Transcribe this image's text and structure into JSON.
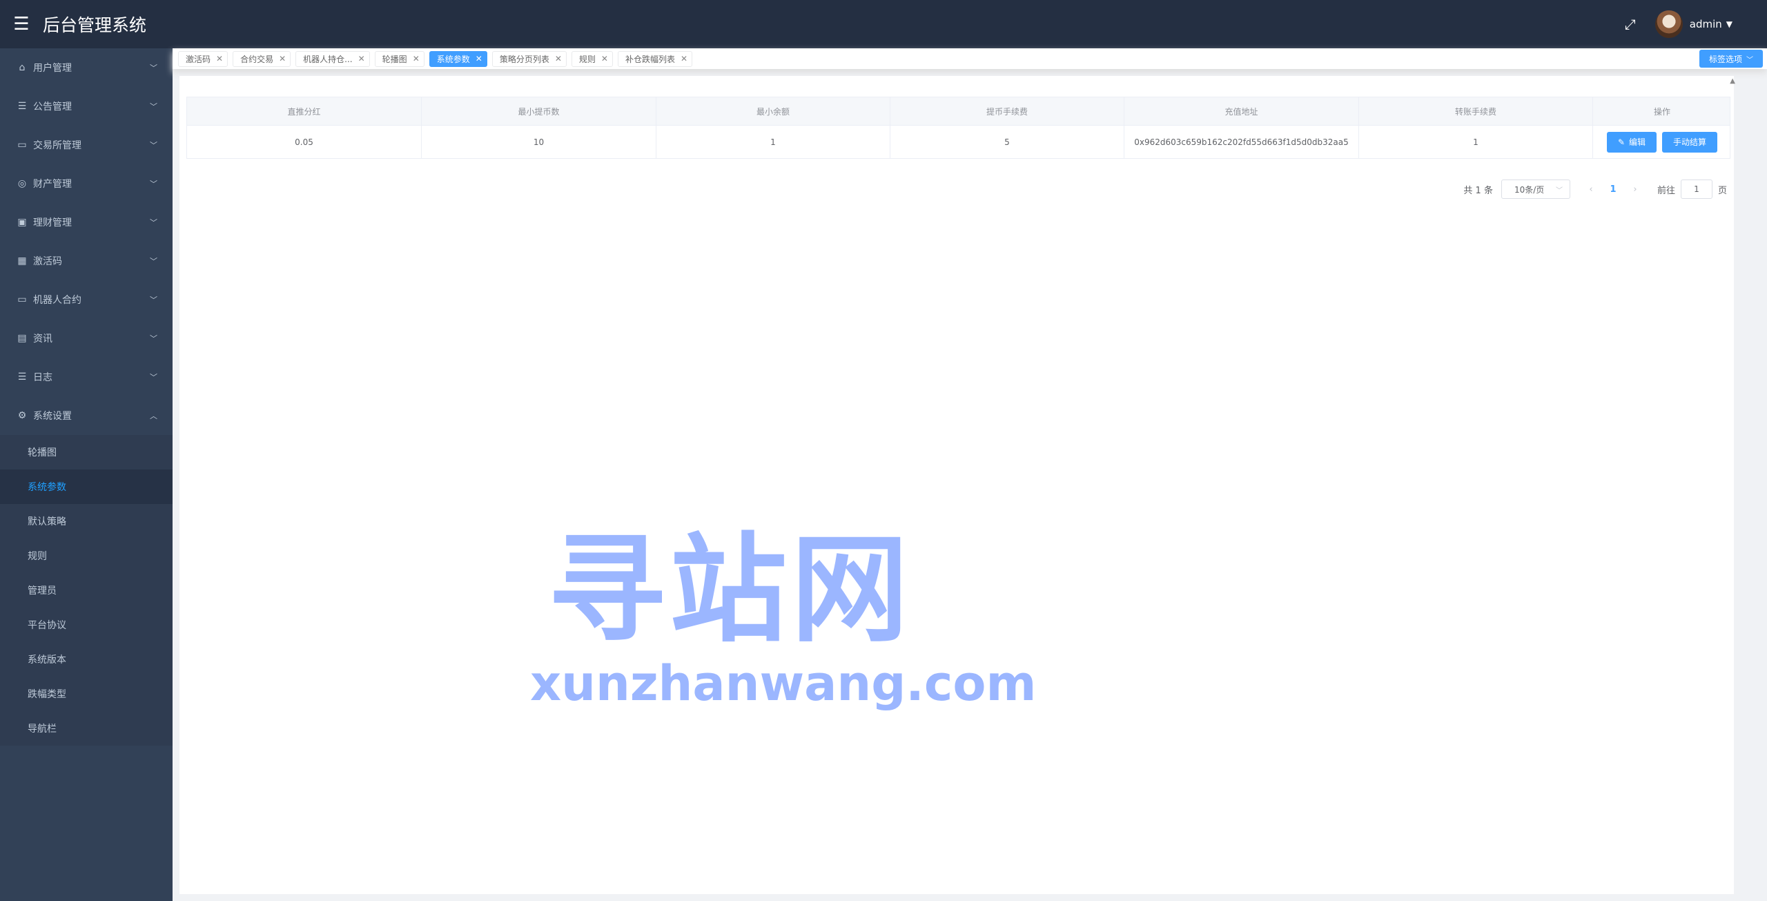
{
  "header": {
    "title": "后台管理系统",
    "collapse_icon": "menu-icon",
    "fullscreen_icon": "fullscreen-icon",
    "username": "admin"
  },
  "sidebar": {
    "items": [
      {
        "label": "用户管理",
        "icon": "home-icon",
        "glyph": "⌂"
      },
      {
        "label": "公告管理",
        "icon": "list-icon",
        "glyph": "☰"
      },
      {
        "label": "交易所管理",
        "icon": "monitor-icon",
        "glyph": "▭"
      },
      {
        "label": "财产管理",
        "icon": "coins-icon",
        "glyph": "◎"
      },
      {
        "label": "理财管理",
        "icon": "bag-icon",
        "glyph": "▣"
      },
      {
        "label": "激活码",
        "icon": "grid-icon",
        "glyph": "▦"
      },
      {
        "label": "机器人合约",
        "icon": "monitor-icon",
        "glyph": "▭"
      },
      {
        "label": "资讯",
        "icon": "document-icon",
        "glyph": "▤"
      },
      {
        "label": "日志",
        "icon": "list-icon",
        "glyph": "☰"
      },
      {
        "label": "系统设置",
        "icon": "gear-icon",
        "glyph": "⚙"
      }
    ],
    "sub_items": [
      "轮播图",
      "系统参数",
      "默认策略",
      "规则",
      "管理员",
      "平台协议",
      "系统版本",
      "跌幅类型",
      "导航栏"
    ],
    "active_sub": "系统参数"
  },
  "tags": {
    "items": [
      "激活码",
      "合约交易",
      "机器人持仓...",
      "轮播图",
      "系统参数",
      "策略分页列表",
      "规则",
      "补仓跌幅列表"
    ],
    "active": "系统参数",
    "options_label": "标签选项"
  },
  "table": {
    "columns": [
      "直推分红",
      "最小提币数",
      "最小余额",
      "提币手续费",
      "充值地址",
      "转账手续费",
      "操作"
    ],
    "rows": [
      {
        "direct_bonus": "0.05",
        "min_withdraw": "10",
        "min_balance": "1",
        "withdraw_fee": "5",
        "deposit_address": "0x962d603c659b162c202fd55d663f1d5d0db32aa5",
        "transfer_fee": "1"
      }
    ],
    "edit_label": "编辑",
    "manual_settle_label": "手动结算"
  },
  "pagination": {
    "total_text": "共 1 条",
    "page_size": "10条/页",
    "current_page": "1",
    "goto_label": "前往",
    "goto_value": "1",
    "page_suffix": "页"
  },
  "watermark": {
    "cn": "寻站网",
    "en": "xunzhanwang.com"
  }
}
